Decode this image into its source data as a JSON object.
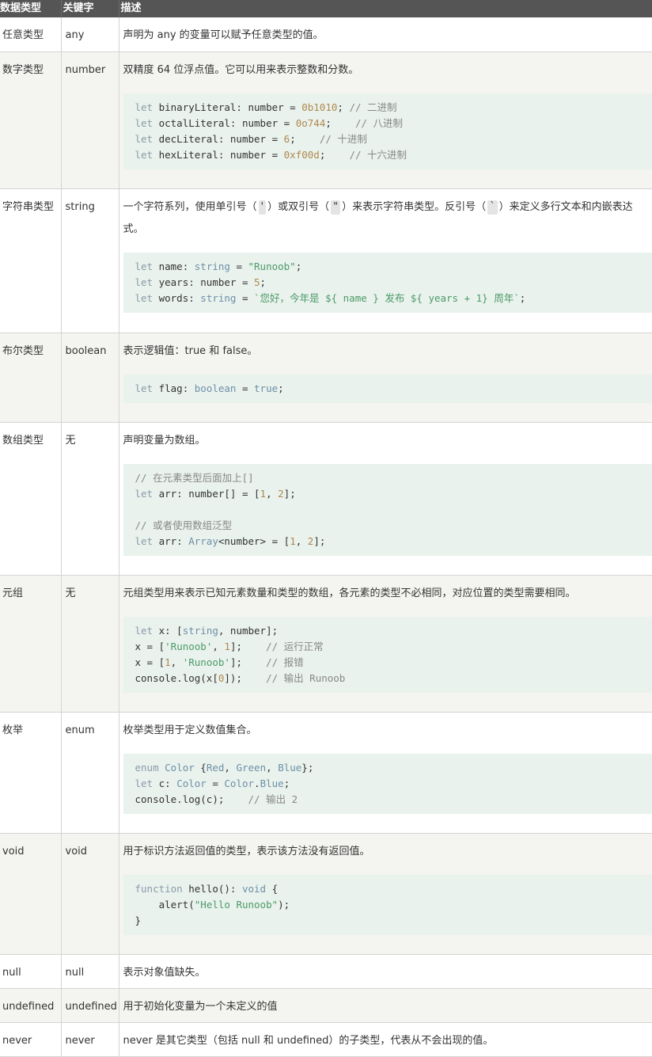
{
  "header": {
    "col1": "数据类型",
    "col2": "关键字",
    "col3": "描述"
  },
  "rows": [
    {
      "type": "任意类型",
      "keyword": "any",
      "desc": "声明为 any 的变量可以赋予任意类型的值。"
    },
    {
      "type": "数字类型",
      "keyword": "number",
      "desc": "双精度 64 位浮点值。它可以用来表示整数和分数。",
      "code": [
        "let binaryLiteral: number = 0b1010; // 二进制",
        "let octalLiteral: number = 0o744;    // 八进制",
        "let decLiteral: number = 6;    // 十进制",
        "let hexLiteral: number = 0xf00d;    // 十六进制"
      ]
    },
    {
      "type": "字符串类型",
      "keyword": "string",
      "desc_parts": [
        "一个字符系列，使用单引号（",
        "'",
        "）或双引号（",
        "\"",
        "）来表示字符串类型。反引号（",
        "`",
        "）来定义多行文本和内嵌表达式。"
      ],
      "code": [
        "let name: string = \"Runoob\";",
        "let years: number = 5;",
        "let words: string = `您好，今年是 ${ name } 发布 ${ years + 1} 周年`;"
      ]
    },
    {
      "type": "布尔类型",
      "keyword": "boolean",
      "desc": "表示逻辑值：true 和 false。",
      "code": [
        "let flag: boolean = true;"
      ]
    },
    {
      "type": "数组类型",
      "keyword": "无",
      "desc": "声明变量为数组。",
      "code": [
        "// 在元素类型后面加上[]",
        "let arr: number[] = [1, 2];",
        "",
        "// 或者使用数组泛型",
        "let arr: Array<number> = [1, 2];"
      ]
    },
    {
      "type": "元组",
      "keyword": "无",
      "desc": "元组类型用来表示已知元素数量和类型的数组，各元素的类型不必相同，对应位置的类型需要相同。",
      "code": [
        "let x: [string, number];",
        "x = ['Runoob', 1];    // 运行正常",
        "x = [1, 'Runoob'];    // 报错",
        "console.log(x[0]);    // 输出 Runoob"
      ]
    },
    {
      "type": "枚举",
      "keyword": "enum",
      "desc": "枚举类型用于定义数值集合。",
      "code": [
        "enum Color {Red, Green, Blue};",
        "let c: Color = Color.Blue;",
        "console.log(c);    // 输出 2"
      ]
    },
    {
      "type": "void",
      "keyword": "void",
      "desc": "用于标识方法返回值的类型，表示该方法没有返回值。",
      "code": [
        "function hello(): void {",
        "    alert(\"Hello Runoob\");",
        "}"
      ]
    },
    {
      "type": "null",
      "keyword": "null",
      "desc": "表示对象值缺失。"
    },
    {
      "type": "undefined",
      "keyword": "undefined",
      "desc": "用于初始化变量为一个未定义的值"
    },
    {
      "type": "never",
      "keyword": "never",
      "desc": "never 是其它类型（包括 null 和 undefined）的子类型，代表从不会出现的值。"
    }
  ]
}
